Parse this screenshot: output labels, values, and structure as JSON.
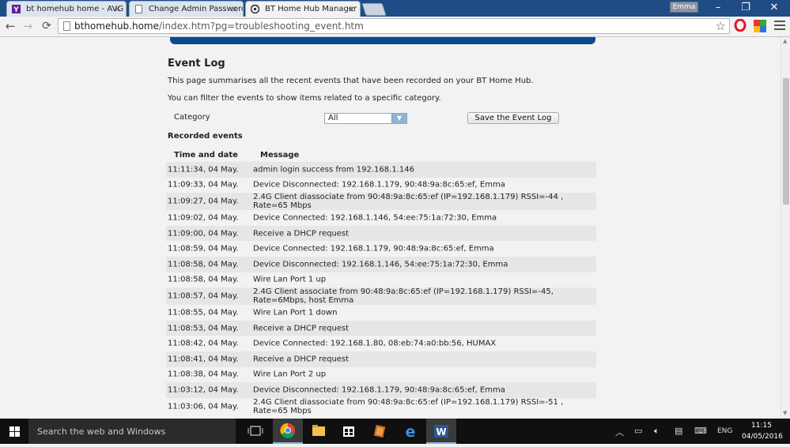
{
  "browser": {
    "tabs": [
      {
        "label": "bt homehub home - AVG",
        "close": "×"
      },
      {
        "label": "Change Admin Password",
        "close": "×"
      },
      {
        "label": "BT Home Hub Manager -",
        "close": "×"
      }
    ],
    "profile_name": "Emma",
    "window_controls": {
      "minimize": "–",
      "restore": "❐",
      "close": "✕"
    },
    "nav": {
      "back": "←",
      "forward": "→",
      "reload": "⟳",
      "star": "☆"
    },
    "url_host": "bthomehub.home",
    "url_path": "/index.htm?pg=troubleshooting_event.htm"
  },
  "page": {
    "title": "Event Log",
    "description1": "This page summarises all the recent events that have been recorded on your BT Home Hub.",
    "description2": "You can filter the events to show items related to a specific category.",
    "category_label": "Category",
    "category_value": "All",
    "save_button": "Save the Event Log",
    "recorded_heading": "Recorded events",
    "columns": {
      "time": "Time and date",
      "message": "Message"
    },
    "events": [
      {
        "time": "11:11:34, 04 May.",
        "message": "admin login success from 192.168.1.146"
      },
      {
        "time": "11:09:33, 04 May.",
        "message": "Device Disconnected: 192.168.1.179, 90:48:9a:8c:65:ef, Emma"
      },
      {
        "time": "11:09:27, 04 May.",
        "message": "2.4G Client diassociate from 90:48:9a:8c:65:ef (IP=192.168.1.179) RSSI=-44 , Rate=65 Mbps"
      },
      {
        "time": "11:09:02, 04 May.",
        "message": "Device Connected: 192.168.1.146, 54:ee:75:1a:72:30, Emma"
      },
      {
        "time": "11:09:00, 04 May.",
        "message": "Receive a DHCP request"
      },
      {
        "time": "11:08:59, 04 May.",
        "message": "Device Connected: 192.168.1.179, 90:48:9a:8c:65:ef, Emma"
      },
      {
        "time": "11:08:58, 04 May.",
        "message": "Device Disconnected: 192.168.1.146, 54:ee:75:1a:72:30, Emma"
      },
      {
        "time": "11:08:58, 04 May.",
        "message": "Wire Lan Port 1 up"
      },
      {
        "time": "11:08:57, 04 May.",
        "message": "2.4G Client associate from 90:48:9a:8c:65:ef (IP=192.168.1.179) RSSI=-45, Rate=6Mbps, host Emma"
      },
      {
        "time": "11:08:55, 04 May.",
        "message": "Wire Lan Port 1 down"
      },
      {
        "time": "11:08:53, 04 May.",
        "message": "Receive a DHCP request"
      },
      {
        "time": "11:08:42, 04 May.",
        "message": "Device Connected: 192.168.1.80, 08:eb:74:a0:bb:56, HUMAX"
      },
      {
        "time": "11:08:41, 04 May.",
        "message": "Receive a DHCP request"
      },
      {
        "time": "11:08:38, 04 May.",
        "message": "Wire Lan Port 2 up"
      },
      {
        "time": "11:03:12, 04 May.",
        "message": "Device Disconnected: 192.168.1.179, 90:48:9a:8c:65:ef, Emma"
      },
      {
        "time": "11:03:06, 04 May.",
        "message": "2.4G Client diassociate from 90:48:9a:8c:65:ef (IP=192.168.1.179) RSSI=-51 , Rate=65 Mbps"
      }
    ]
  },
  "taskbar": {
    "search_placeholder": "Search the web and Windows",
    "language": "ENG",
    "time": "11:15",
    "date": "04/05/2016"
  },
  "colors": {
    "accent_blue": "#0a4a8f",
    "row_shade": "#e6e6e6",
    "tab_strip": "#1f4b86"
  }
}
